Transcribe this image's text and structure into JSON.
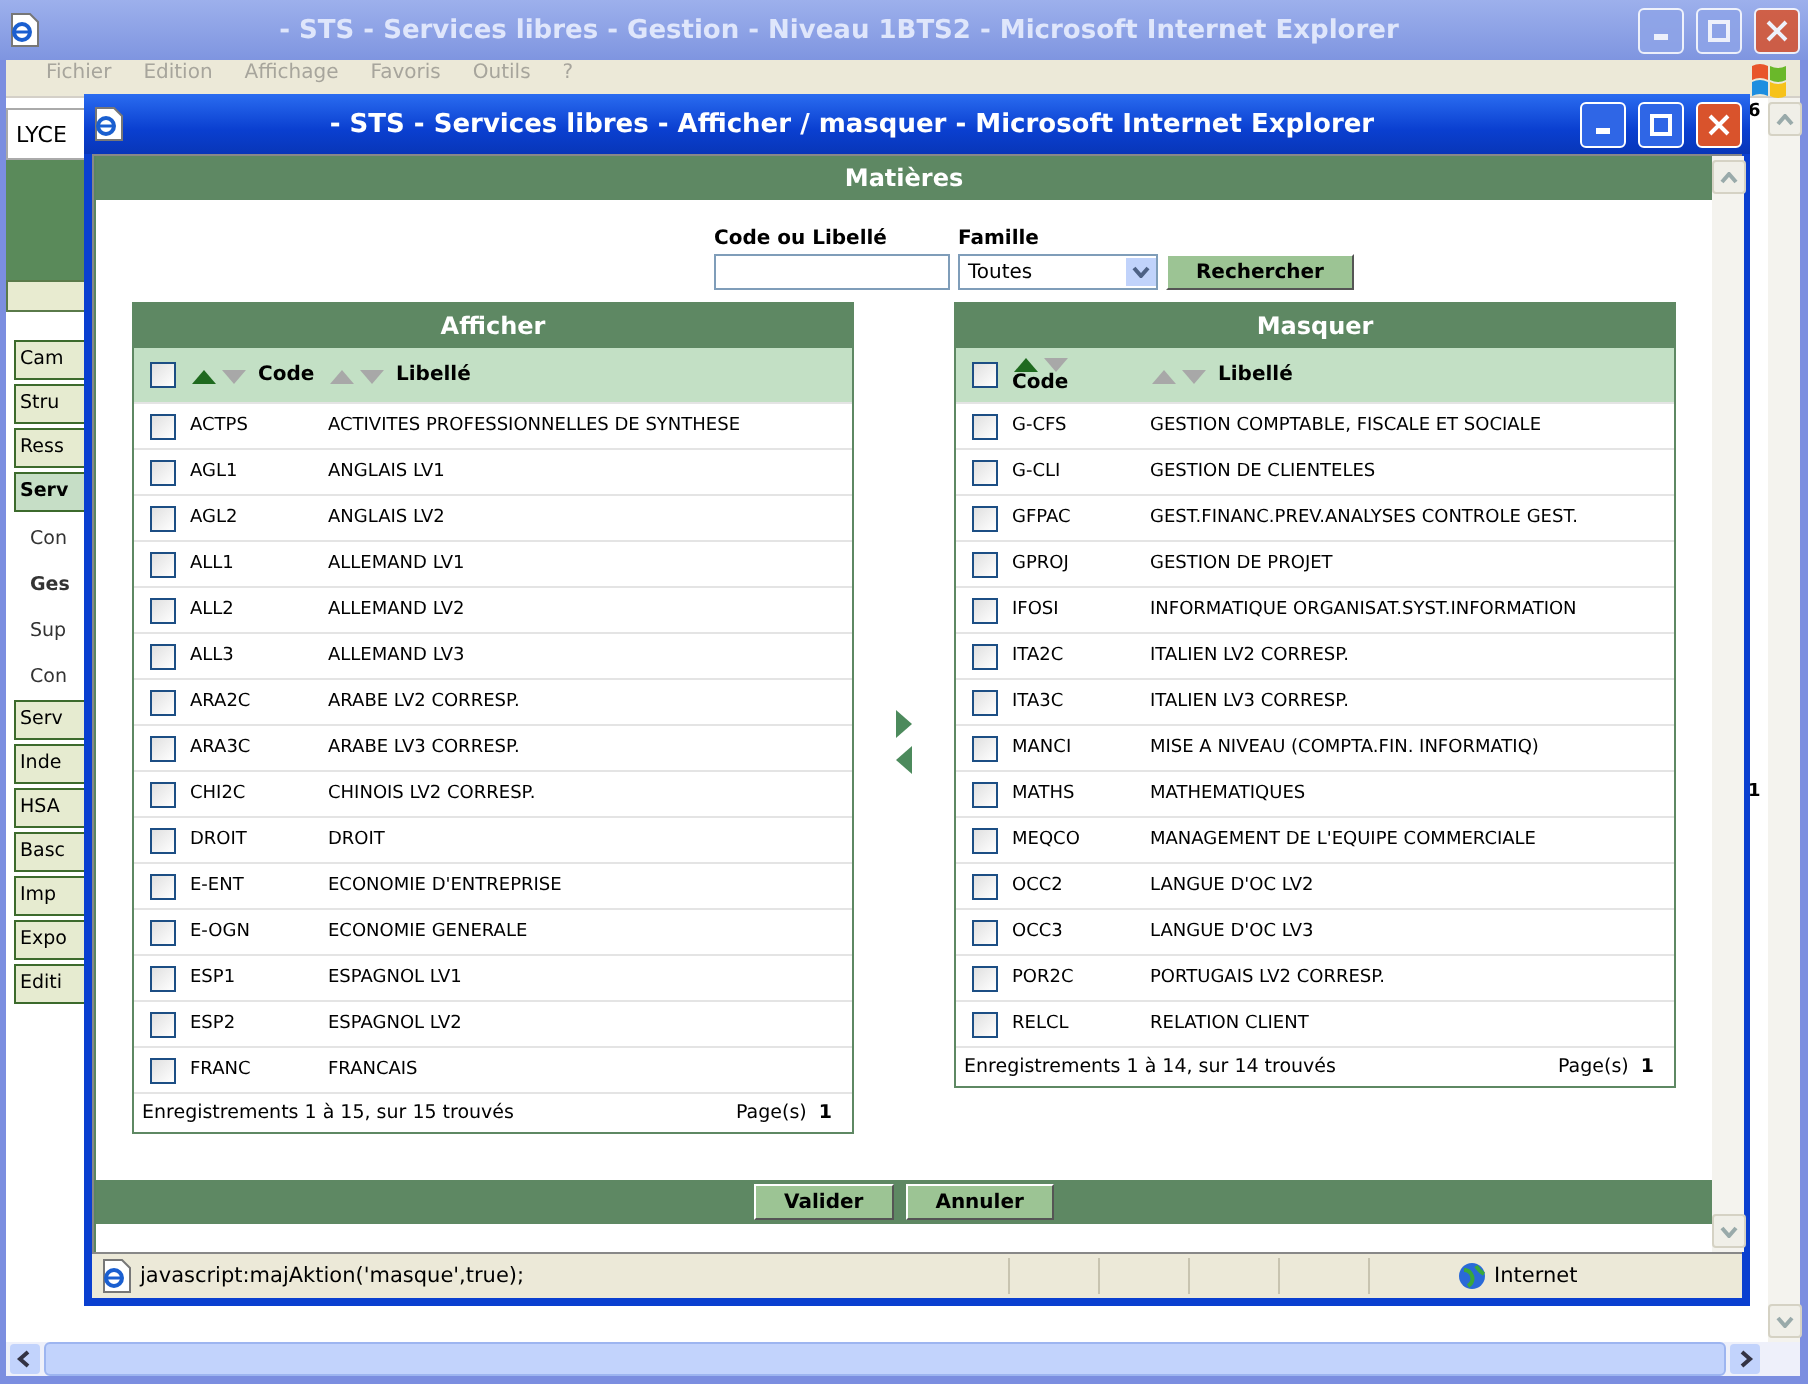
{
  "window": {
    "title": "- STS - Services libres - Gestion - Niveau 1BTS2 - Microsoft Internet Explorer"
  },
  "menu": [
    "Fichier",
    "Edition",
    "Affichage",
    "Favoris",
    "Outils",
    "?"
  ],
  "background": {
    "banner_text": "LYCE",
    "corner_text": "6",
    "side_text": "1",
    "sidebar": [
      {
        "label": "Cam",
        "kind": "section",
        "selected": false
      },
      {
        "label": "Stru",
        "kind": "section",
        "selected": false
      },
      {
        "label": "Ress",
        "kind": "section",
        "selected": false
      },
      {
        "label": "Serv",
        "kind": "section",
        "selected": true
      },
      {
        "label": "Con",
        "kind": "sub",
        "selected": false
      },
      {
        "label": "Ges",
        "kind": "sub",
        "selected": true
      },
      {
        "label": "Sup",
        "kind": "sub",
        "selected": false
      },
      {
        "label": "Con",
        "kind": "sub",
        "selected": false
      },
      {
        "label": "Serv",
        "kind": "section",
        "selected": false
      },
      {
        "label": "Inde",
        "kind": "section",
        "selected": false
      },
      {
        "label": "HSA",
        "kind": "section",
        "selected": false
      },
      {
        "label": "Basc",
        "kind": "section",
        "selected": false
      },
      {
        "label": "Imp",
        "kind": "section",
        "selected": false
      },
      {
        "label": "Expo",
        "kind": "section",
        "selected": false
      },
      {
        "label": "Editi",
        "kind": "section",
        "selected": false
      }
    ]
  },
  "popup": {
    "title": "- STS - Services libres - Afficher / masquer - Microsoft Internet Explorer",
    "heading": "Matières",
    "search": {
      "code_label": "Code ou Libellé",
      "family_label": "Famille",
      "family_value": "Toutes",
      "button": "Rechercher"
    },
    "panels": [
      {
        "title": "Afficher",
        "all_checked": false,
        "columns": [
          {
            "label": "Code",
            "sorted": true
          },
          {
            "label": "Libellé",
            "sorted": false
          }
        ],
        "rows": [
          {
            "code": "ACTPS",
            "label": "ACTIVITES PROFESSIONNELLES DE SYNTHESE",
            "checked": false
          },
          {
            "code": "AGL1",
            "label": "ANGLAIS LV1",
            "checked": false
          },
          {
            "code": "AGL2",
            "label": "ANGLAIS LV2",
            "checked": false
          },
          {
            "code": "ALL1",
            "label": "ALLEMAND LV1",
            "checked": false
          },
          {
            "code": "ALL2",
            "label": "ALLEMAND LV2",
            "checked": false
          },
          {
            "code": "ALL3",
            "label": "ALLEMAND LV3",
            "checked": false
          },
          {
            "code": "ARA2C",
            "label": "ARABE LV2 CORRESP.",
            "checked": false
          },
          {
            "code": "ARA3C",
            "label": "ARABE LV3 CORRESP.",
            "checked": false
          },
          {
            "code": "CHI2C",
            "label": "CHINOIS LV2 CORRESP.",
            "checked": false
          },
          {
            "code": "DROIT",
            "label": "DROIT",
            "checked": false
          },
          {
            "code": "E-ENT",
            "label": "ECONOMIE D'ENTREPRISE",
            "checked": false
          },
          {
            "code": "E-OGN",
            "label": "ECONOMIE GENERALE",
            "checked": false
          },
          {
            "code": "ESP1",
            "label": "ESPAGNOL LV1",
            "checked": false
          },
          {
            "code": "ESP2",
            "label": "ESPAGNOL LV2",
            "checked": false
          },
          {
            "code": "FRANC",
            "label": "FRANCAIS",
            "checked": false
          }
        ],
        "footer": "Enregistrements 1 à 15, sur 15 trouvés",
        "pages_label": "Page(s)",
        "page": "1"
      },
      {
        "title": "Masquer",
        "all_checked": false,
        "columns": [
          {
            "label": "Code",
            "sorted": true
          },
          {
            "label": "Libellé",
            "sorted": false
          }
        ],
        "rows": [
          {
            "code": "G-CFS",
            "label": "GESTION COMPTABLE, FISCALE ET SOCIALE",
            "checked": false
          },
          {
            "code": "G-CLI",
            "label": "GESTION DE CLIENTELES",
            "checked": false
          },
          {
            "code": "GFPAC",
            "label": "GEST.FINANC.PREV.ANALYSES CONTROLE GEST.",
            "checked": false
          },
          {
            "code": "GPROJ",
            "label": "GESTION DE PROJET",
            "checked": false
          },
          {
            "code": "IFOSI",
            "label": "INFORMATIQUE ORGANISAT.SYST.INFORMATION",
            "checked": false
          },
          {
            "code": "ITA2C",
            "label": "ITALIEN LV2 CORRESP.",
            "checked": false
          },
          {
            "code": "ITA3C",
            "label": "ITALIEN LV3 CORRESP.",
            "checked": false
          },
          {
            "code": "MANCI",
            "label": "MISE A NIVEAU (COMPTA.FIN. INFORMATIQ)",
            "checked": false
          },
          {
            "code": "MATHS",
            "label": "MATHEMATIQUES",
            "checked": false
          },
          {
            "code": "MEQCO",
            "label": "MANAGEMENT DE L'EQUIPE COMMERCIALE",
            "checked": false
          },
          {
            "code": "OCC2",
            "label": "LANGUE D'OC LV2",
            "checked": false
          },
          {
            "code": "OCC3",
            "label": "LANGUE D'OC LV3",
            "checked": false
          },
          {
            "code": "POR2C",
            "label": "PORTUGAIS LV2 CORRESP.",
            "checked": false
          },
          {
            "code": "RELCL",
            "label": "RELATION CLIENT",
            "checked": false
          }
        ],
        "footer": "Enregistrements 1 à 14, sur 14 trouvés",
        "pages_label": "Page(s)",
        "page": "1"
      }
    ],
    "buttons": [
      "Valider",
      "Annuler"
    ],
    "status": {
      "text": "javascript:majAktion('masque',true);",
      "zone": "Internet"
    }
  }
}
